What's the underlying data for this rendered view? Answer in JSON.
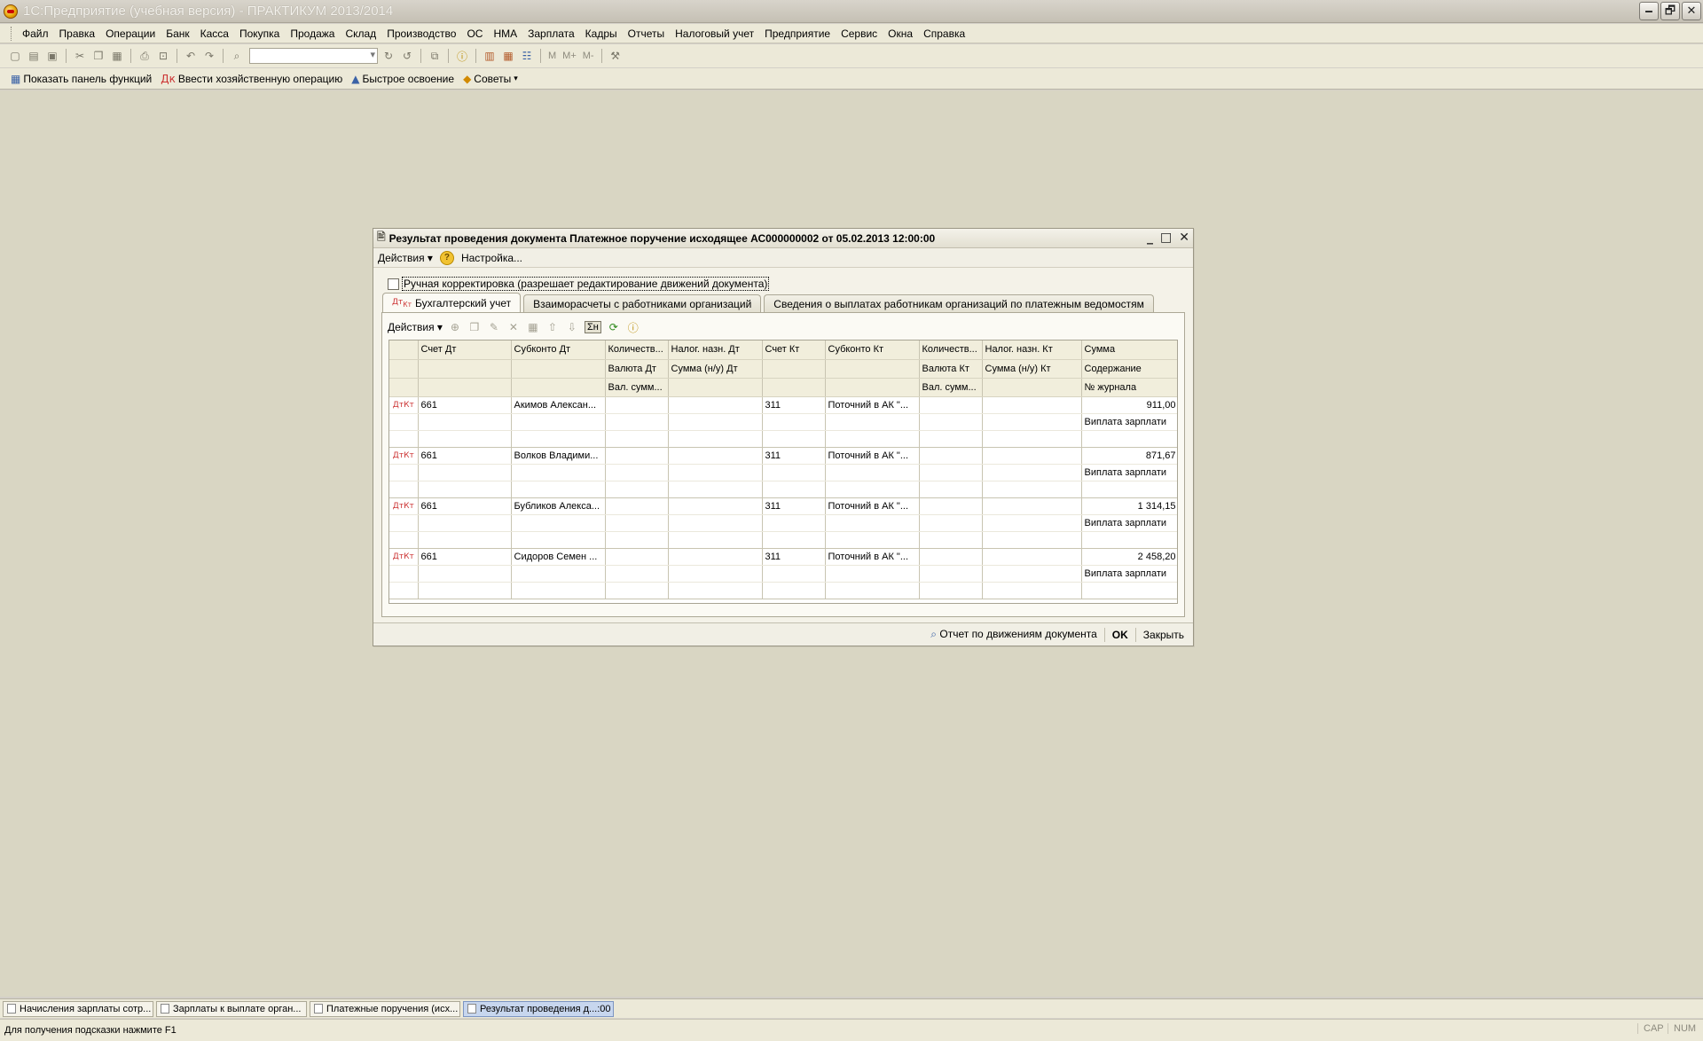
{
  "window": {
    "title": "1С:Предприятие (учебная версия) - ПРАКТИКУМ 2013/2014",
    "controls": [
      "🗕",
      "🗗",
      "✕"
    ]
  },
  "menubar": [
    "Файл",
    "Правка",
    "Операции",
    "Банк",
    "Касса",
    "Покупка",
    "Продажа",
    "Склад",
    "Производство",
    "ОС",
    "НМА",
    "Зарплата",
    "Кадры",
    "Отчеты",
    "Налоговый учет",
    "Предприятие",
    "Сервис",
    "Окна",
    "Справка"
  ],
  "toolbar": {
    "marks": [
      "M",
      "M+",
      "M-"
    ]
  },
  "funcbar": {
    "show_panel": "Показать панель функций",
    "enter_operation": "Ввести хозяйственную операцию",
    "quick_start": "Быстрое освоение",
    "tips": "Советы"
  },
  "dialog": {
    "title": "Результат проведения документа Платежное поручение исходящее АС000000002 от 05.02.2013 12:00:00",
    "menu_actions": "Действия ▾",
    "menu_settings": "Настройка...",
    "manual_correction": "Ручная корректировка (разрешает редактирование движений документа)",
    "tabs": [
      "Бухгалтерский учет",
      "Взаиморасчеты с работниками организаций",
      "Сведения о выплатах работникам организаций по платежным ведомостям"
    ],
    "panel_actions": "Действия ▾",
    "sum_toggle": "Σн",
    "columns": {
      "r1": [
        "Счет Дт",
        "Субконто Дт",
        "Количеств...",
        "Налог. назн. Дт",
        "Счет Кт",
        "Субконто Кт",
        "Количеств...",
        "Налог. назн. Кт",
        "Сумма"
      ],
      "r2": [
        "",
        "",
        "Валюта Дт",
        "Сумма (н/у) Дт",
        "",
        "",
        "Валюта Кт",
        "Сумма (н/у) Кт",
        "Содержание"
      ],
      "r3": [
        "",
        "",
        "Вал. сумм...",
        "",
        "",
        "",
        "Вал. сумм...",
        "",
        "№ журнала"
      ]
    },
    "rows": [
      {
        "icon": "ДтКт",
        "acc_dt": "661",
        "sub_dt": "Акимов Алексан...",
        "acc_kt": "311",
        "sub_kt": "Поточний в АК \"...",
        "sum": "911,00",
        "content": "Виплата зарплати"
      },
      {
        "icon": "ДтКт",
        "acc_dt": "661",
        "sub_dt": "Волков Владими...",
        "acc_kt": "311",
        "sub_kt": "Поточний в АК \"...",
        "sum": "871,67",
        "content": "Виплата зарплати"
      },
      {
        "icon": "ДтКт",
        "acc_dt": "661",
        "sub_dt": "Бубликов Алекса...",
        "acc_kt": "311",
        "sub_kt": "Поточний в АК \"...",
        "sum": "1 314,15",
        "content": "Виплата зарплати"
      },
      {
        "icon": "ДтКт",
        "acc_dt": "661",
        "sub_dt": "Сидоров Семен ...",
        "acc_kt": "311",
        "sub_kt": "Поточний в АК \"...",
        "sum": "2 458,20",
        "content": "Виплата зарплати"
      }
    ],
    "bottom": {
      "report": "Отчет по движениям документа",
      "ok": "OK",
      "close": "Закрыть"
    }
  },
  "taskbar": [
    {
      "label": "Начисления зарплаты сотр...",
      "active": false
    },
    {
      "label": "Зарплаты к выплате орган...",
      "active": false
    },
    {
      "label": "Платежные поручения (исх...",
      "active": false
    },
    {
      "label": "Результат проведения д...:00",
      "active": true
    }
  ],
  "statusbar": {
    "hint": "Для получения подсказки нажмите F1",
    "cap": "CAP",
    "num": "NUM"
  }
}
